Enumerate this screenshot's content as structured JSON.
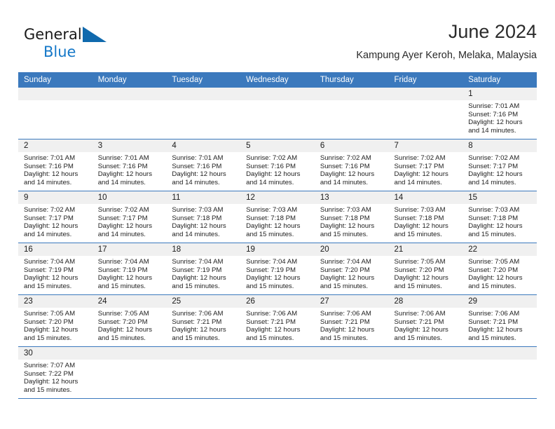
{
  "brand": {
    "name_part1": "General",
    "name_part2": "Blue",
    "flag_icon": "blue-triangle-flag-icon",
    "accent_color": "#1578c8"
  },
  "header": {
    "title": "June 2024",
    "subtitle": "Kampung Ayer Keroh, Melaka, Malaysia"
  },
  "theme": {
    "header_blue": "#3b79bd",
    "daynum_bg": "#f0f0f0",
    "text": "#222222"
  },
  "calendar": {
    "weekday_headers": [
      "Sunday",
      "Monday",
      "Tuesday",
      "Wednesday",
      "Thursday",
      "Friday",
      "Saturday"
    ],
    "weeks": [
      [
        {
          "day": "",
          "empty": true
        },
        {
          "day": "",
          "empty": true
        },
        {
          "day": "",
          "empty": true
        },
        {
          "day": "",
          "empty": true
        },
        {
          "day": "",
          "empty": true
        },
        {
          "day": "",
          "empty": true
        },
        {
          "day": "1",
          "sunrise": "Sunrise: 7:01 AM",
          "sunset": "Sunset: 7:16 PM",
          "daylight1": "Daylight: 12 hours",
          "daylight2": "and 14 minutes."
        }
      ],
      [
        {
          "day": "2",
          "sunrise": "Sunrise: 7:01 AM",
          "sunset": "Sunset: 7:16 PM",
          "daylight1": "Daylight: 12 hours",
          "daylight2": "and 14 minutes."
        },
        {
          "day": "3",
          "sunrise": "Sunrise: 7:01 AM",
          "sunset": "Sunset: 7:16 PM",
          "daylight1": "Daylight: 12 hours",
          "daylight2": "and 14 minutes."
        },
        {
          "day": "4",
          "sunrise": "Sunrise: 7:01 AM",
          "sunset": "Sunset: 7:16 PM",
          "daylight1": "Daylight: 12 hours",
          "daylight2": "and 14 minutes."
        },
        {
          "day": "5",
          "sunrise": "Sunrise: 7:02 AM",
          "sunset": "Sunset: 7:16 PM",
          "daylight1": "Daylight: 12 hours",
          "daylight2": "and 14 minutes."
        },
        {
          "day": "6",
          "sunrise": "Sunrise: 7:02 AM",
          "sunset": "Sunset: 7:16 PM",
          "daylight1": "Daylight: 12 hours",
          "daylight2": "and 14 minutes."
        },
        {
          "day": "7",
          "sunrise": "Sunrise: 7:02 AM",
          "sunset": "Sunset: 7:17 PM",
          "daylight1": "Daylight: 12 hours",
          "daylight2": "and 14 minutes."
        },
        {
          "day": "8",
          "sunrise": "Sunrise: 7:02 AM",
          "sunset": "Sunset: 7:17 PM",
          "daylight1": "Daylight: 12 hours",
          "daylight2": "and 14 minutes."
        }
      ],
      [
        {
          "day": "9",
          "sunrise": "Sunrise: 7:02 AM",
          "sunset": "Sunset: 7:17 PM",
          "daylight1": "Daylight: 12 hours",
          "daylight2": "and 14 minutes."
        },
        {
          "day": "10",
          "sunrise": "Sunrise: 7:02 AM",
          "sunset": "Sunset: 7:17 PM",
          "daylight1": "Daylight: 12 hours",
          "daylight2": "and 14 minutes."
        },
        {
          "day": "11",
          "sunrise": "Sunrise: 7:03 AM",
          "sunset": "Sunset: 7:18 PM",
          "daylight1": "Daylight: 12 hours",
          "daylight2": "and 14 minutes."
        },
        {
          "day": "12",
          "sunrise": "Sunrise: 7:03 AM",
          "sunset": "Sunset: 7:18 PM",
          "daylight1": "Daylight: 12 hours",
          "daylight2": "and 15 minutes."
        },
        {
          "day": "13",
          "sunrise": "Sunrise: 7:03 AM",
          "sunset": "Sunset: 7:18 PM",
          "daylight1": "Daylight: 12 hours",
          "daylight2": "and 15 minutes."
        },
        {
          "day": "14",
          "sunrise": "Sunrise: 7:03 AM",
          "sunset": "Sunset: 7:18 PM",
          "daylight1": "Daylight: 12 hours",
          "daylight2": "and 15 minutes."
        },
        {
          "day": "15",
          "sunrise": "Sunrise: 7:03 AM",
          "sunset": "Sunset: 7:18 PM",
          "daylight1": "Daylight: 12 hours",
          "daylight2": "and 15 minutes."
        }
      ],
      [
        {
          "day": "16",
          "sunrise": "Sunrise: 7:04 AM",
          "sunset": "Sunset: 7:19 PM",
          "daylight1": "Daylight: 12 hours",
          "daylight2": "and 15 minutes."
        },
        {
          "day": "17",
          "sunrise": "Sunrise: 7:04 AM",
          "sunset": "Sunset: 7:19 PM",
          "daylight1": "Daylight: 12 hours",
          "daylight2": "and 15 minutes."
        },
        {
          "day": "18",
          "sunrise": "Sunrise: 7:04 AM",
          "sunset": "Sunset: 7:19 PM",
          "daylight1": "Daylight: 12 hours",
          "daylight2": "and 15 minutes."
        },
        {
          "day": "19",
          "sunrise": "Sunrise: 7:04 AM",
          "sunset": "Sunset: 7:19 PM",
          "daylight1": "Daylight: 12 hours",
          "daylight2": "and 15 minutes."
        },
        {
          "day": "20",
          "sunrise": "Sunrise: 7:04 AM",
          "sunset": "Sunset: 7:20 PM",
          "daylight1": "Daylight: 12 hours",
          "daylight2": "and 15 minutes."
        },
        {
          "day": "21",
          "sunrise": "Sunrise: 7:05 AM",
          "sunset": "Sunset: 7:20 PM",
          "daylight1": "Daylight: 12 hours",
          "daylight2": "and 15 minutes."
        },
        {
          "day": "22",
          "sunrise": "Sunrise: 7:05 AM",
          "sunset": "Sunset: 7:20 PM",
          "daylight1": "Daylight: 12 hours",
          "daylight2": "and 15 minutes."
        }
      ],
      [
        {
          "day": "23",
          "sunrise": "Sunrise: 7:05 AM",
          "sunset": "Sunset: 7:20 PM",
          "daylight1": "Daylight: 12 hours",
          "daylight2": "and 15 minutes."
        },
        {
          "day": "24",
          "sunrise": "Sunrise: 7:05 AM",
          "sunset": "Sunset: 7:20 PM",
          "daylight1": "Daylight: 12 hours",
          "daylight2": "and 15 minutes."
        },
        {
          "day": "25",
          "sunrise": "Sunrise: 7:06 AM",
          "sunset": "Sunset: 7:21 PM",
          "daylight1": "Daylight: 12 hours",
          "daylight2": "and 15 minutes."
        },
        {
          "day": "26",
          "sunrise": "Sunrise: 7:06 AM",
          "sunset": "Sunset: 7:21 PM",
          "daylight1": "Daylight: 12 hours",
          "daylight2": "and 15 minutes."
        },
        {
          "day": "27",
          "sunrise": "Sunrise: 7:06 AM",
          "sunset": "Sunset: 7:21 PM",
          "daylight1": "Daylight: 12 hours",
          "daylight2": "and 15 minutes."
        },
        {
          "day": "28",
          "sunrise": "Sunrise: 7:06 AM",
          "sunset": "Sunset: 7:21 PM",
          "daylight1": "Daylight: 12 hours",
          "daylight2": "and 15 minutes."
        },
        {
          "day": "29",
          "sunrise": "Sunrise: 7:06 AM",
          "sunset": "Sunset: 7:21 PM",
          "daylight1": "Daylight: 12 hours",
          "daylight2": "and 15 minutes."
        }
      ],
      [
        {
          "day": "30",
          "sunrise": "Sunrise: 7:07 AM",
          "sunset": "Sunset: 7:22 PM",
          "daylight1": "Daylight: 12 hours",
          "daylight2": "and 15 minutes."
        },
        {
          "day": "",
          "empty": true
        },
        {
          "day": "",
          "empty": true
        },
        {
          "day": "",
          "empty": true
        },
        {
          "day": "",
          "empty": true
        },
        {
          "day": "",
          "empty": true
        },
        {
          "day": "",
          "empty": true
        }
      ]
    ]
  }
}
